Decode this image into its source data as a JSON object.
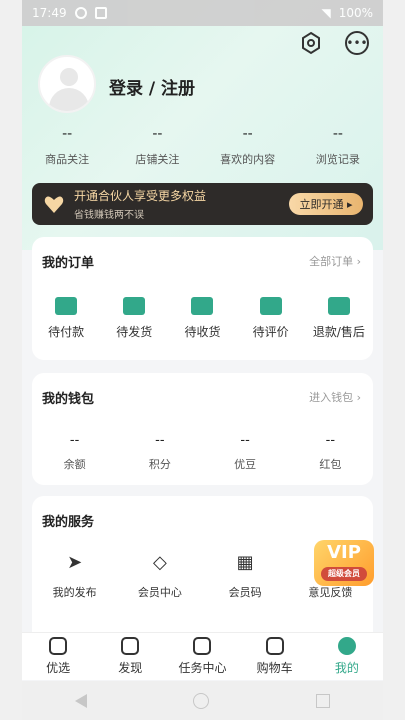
{
  "status": {
    "time": "17:49",
    "battery": "100%"
  },
  "profile": {
    "login_label": "登录 / 注册"
  },
  "stats": [
    {
      "value": "--",
      "label": "商品关注"
    },
    {
      "value": "--",
      "label": "店铺关注"
    },
    {
      "value": "--",
      "label": "喜欢的内容"
    },
    {
      "value": "--",
      "label": "浏览记录"
    }
  ],
  "vip_banner": {
    "title": "开通合伙人享受更多权益",
    "subtitle": "省钱赚钱两不误",
    "button": "立即开通 ▸"
  },
  "orders": {
    "title": "我的订单",
    "link": "全部订单 ›",
    "items": [
      "待付款",
      "待发货",
      "待收货",
      "待评价",
      "退款/售后"
    ]
  },
  "wallet": {
    "title": "我的钱包",
    "link": "进入钱包 ›",
    "items": [
      {
        "value": "--",
        "label": "余额"
      },
      {
        "value": "--",
        "label": "积分"
      },
      {
        "value": "--",
        "label": "优豆"
      },
      {
        "value": "--",
        "label": "红包"
      }
    ]
  },
  "services": {
    "title": "我的服务",
    "items": [
      {
        "label": "我的发布",
        "icon": "send-icon"
      },
      {
        "label": "会员中心",
        "icon": "diamond-icon"
      },
      {
        "label": "会员码",
        "icon": "qr-code-icon"
      },
      {
        "label": "意见反馈",
        "icon": "feedback-icon"
      }
    ],
    "vip_badge": {
      "title": "VIP",
      "subtitle": "超级会员"
    }
  },
  "bottom_nav": [
    {
      "label": "优选",
      "icon": "bag-icon"
    },
    {
      "label": "发现",
      "icon": "compass-icon"
    },
    {
      "label": "任务中心",
      "icon": "calendar-icon"
    },
    {
      "label": "购物车",
      "icon": "cart-icon"
    },
    {
      "label": "我的",
      "icon": "profile-icon",
      "active": true
    }
  ],
  "colors": {
    "accent": "#32a88a",
    "banner": "#2e2b29",
    "gold": "#f6d7a4"
  }
}
